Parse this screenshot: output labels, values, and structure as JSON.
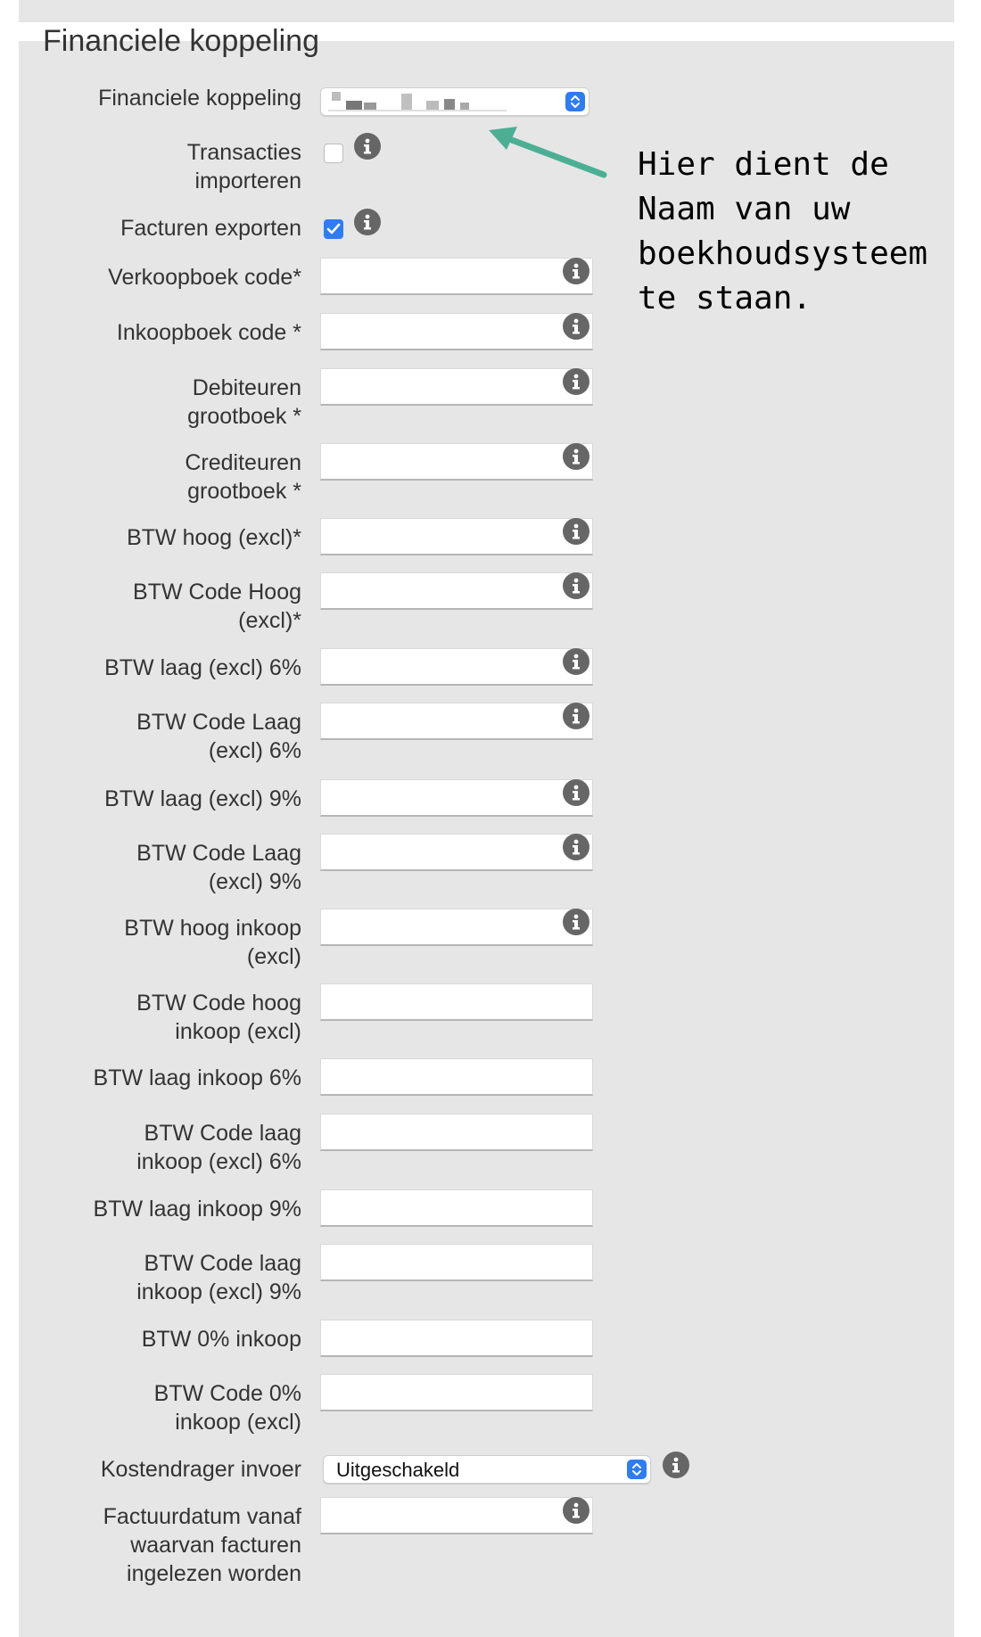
{
  "section": {
    "title": "Financiele koppeling"
  },
  "fields": [
    {
      "label": "Financiele koppeling",
      "type": "select-blurred"
    },
    {
      "label": "Transacties\nimporteren",
      "type": "checkbox",
      "checked": false,
      "info": true
    },
    {
      "label": "Facturen exporten",
      "type": "checkbox",
      "checked": true,
      "info": true
    },
    {
      "label": "Verkoopboek code*",
      "type": "text",
      "value": "",
      "info": true
    },
    {
      "label": "Inkoopboek code *",
      "type": "text",
      "value": "",
      "info": true
    },
    {
      "label": "Debiteuren\ngrootboek *",
      "type": "text",
      "value": "",
      "info": true
    },
    {
      "label": "Crediteuren\ngrootboek *",
      "type": "text",
      "value": "",
      "info": true
    },
    {
      "label": "BTW hoog (excl)*",
      "type": "text",
      "value": "",
      "info": true
    },
    {
      "label": "BTW Code Hoog\n(excl)*",
      "type": "text",
      "value": "",
      "info": true
    },
    {
      "label": "BTW laag (excl) 6%",
      "type": "text",
      "value": "",
      "info": true
    },
    {
      "label": "BTW Code Laag\n(excl) 6%",
      "type": "text",
      "value": "",
      "info": true
    },
    {
      "label": "BTW laag (excl) 9%",
      "type": "text",
      "value": "",
      "info": true
    },
    {
      "label": "BTW Code Laag\n(excl) 9%",
      "type": "text",
      "value": "",
      "info": true
    },
    {
      "label": "BTW hoog inkoop\n(excl)",
      "type": "text",
      "value": "",
      "info": true
    },
    {
      "label": "BTW Code hoog\ninkoop (excl)",
      "type": "text",
      "value": "",
      "info": false
    },
    {
      "label": "BTW laag inkoop 6%",
      "type": "text",
      "value": "",
      "info": false
    },
    {
      "label": "BTW Code laag\ninkoop (excl) 6%",
      "type": "text",
      "value": "",
      "info": false
    },
    {
      "label": "BTW laag inkoop 9%",
      "type": "text",
      "value": "",
      "info": false
    },
    {
      "label": "BTW Code laag\ninkoop (excl) 9%",
      "type": "text",
      "value": "",
      "info": false
    },
    {
      "label": "BTW 0% inkoop",
      "type": "text",
      "value": "",
      "info": false
    },
    {
      "label": "BTW Code 0%\ninkoop (excl)",
      "type": "text",
      "value": "",
      "info": false
    },
    {
      "label": "Kostendrager invoer",
      "type": "select",
      "value": "Uitgeschakeld",
      "info": true
    },
    {
      "label": "Factuurdatum vanaf\nwaarvan facturen\ningelezen worden",
      "type": "text",
      "value": "",
      "info": true
    }
  ],
  "annotation": {
    "text": "Hier dient de\nNaam van uw\nboekhoudsysteem\nte staan."
  },
  "colors": {
    "accent": "#2e7cf6",
    "arrow": "#4caf94",
    "panel": "#e6e6e6",
    "info_icon": "#666666"
  },
  "icons": {
    "info": "info-icon",
    "check": "checkmark-icon",
    "select_arrows": "chevron-up-down-icon"
  }
}
